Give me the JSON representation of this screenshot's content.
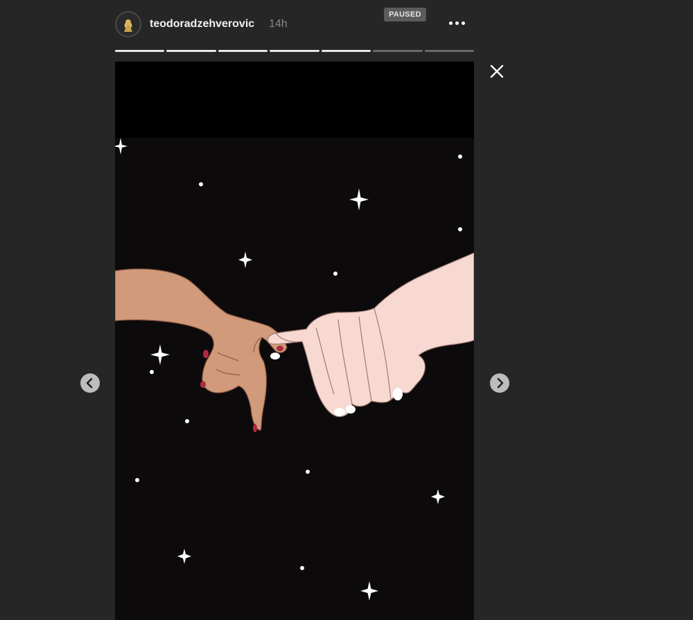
{
  "story": {
    "username": "teodoradzehverovic",
    "time_ago": "14h",
    "status_badge": "PAUSED",
    "progress": {
      "total_segments": 7,
      "completed_segments": 5
    }
  },
  "icons": {
    "more": "more-options-icon",
    "close": "close-icon",
    "prev": "chevron-left-icon",
    "next": "chevron-right-icon"
  },
  "colors": {
    "background": "#262626",
    "story_sky": "#0d0a0b",
    "left_hand_skin": "#d19a7a",
    "right_hand_skin": "#f8d9d2",
    "nail_polish": "#b02b40",
    "star": "#ffffff"
  }
}
